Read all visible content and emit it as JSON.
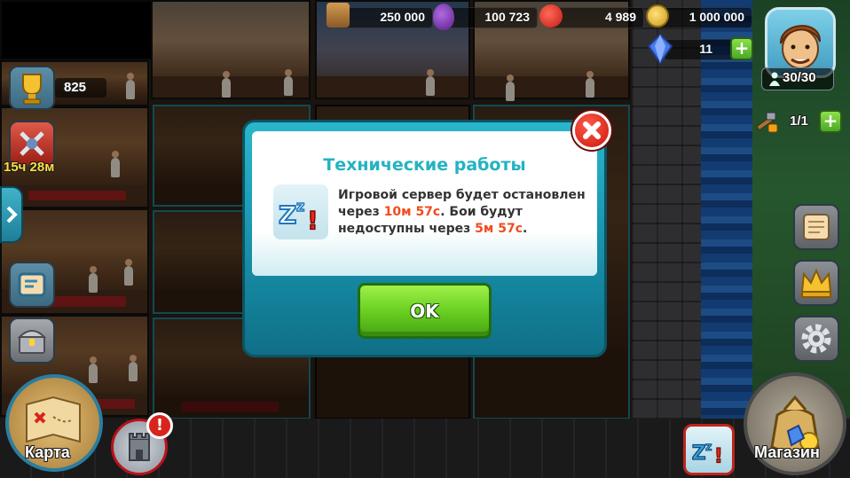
{
  "resources": {
    "wood": "250 000",
    "potion": "100 723",
    "food": "4 989",
    "gold": "1 000 000",
    "gems": "11"
  },
  "player": {
    "population": "30/30",
    "builders": "1/1"
  },
  "left_panel": {
    "trophies": "825",
    "battle_timer": "15ч 28м"
  },
  "bottom": {
    "map_label": "Карта",
    "shop_label": "Магазин",
    "alert_mark": "!"
  },
  "modal": {
    "title": "Технические работы",
    "text_part1": "Игровой сервер будет остановлен через ",
    "time1": "10м 57с",
    "text_part2": ". Бои будут недоступны через ",
    "time2": "5м 57с",
    "text_part3": ".",
    "ok_label": "OK"
  },
  "colors": {
    "accent_teal": "#23b3c2",
    "timer_highlight": "#f24b1e",
    "ok_green": "#6ad022",
    "close_red": "#d8241c"
  }
}
